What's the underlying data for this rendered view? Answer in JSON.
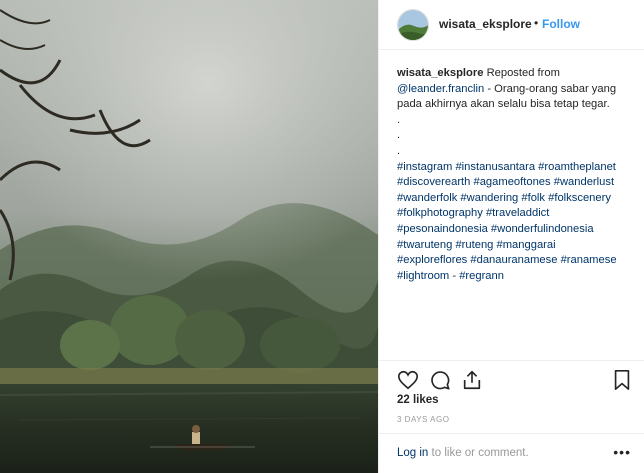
{
  "post": {
    "username": "wisata_eksplore",
    "separator": "•",
    "follow_label": "Follow"
  },
  "caption": {
    "username": "wisata_eksplore",
    "reposted_from": "Reposted from",
    "mention": "@leander.franclin",
    "text_1": "- Orang-orang sabar yang",
    "text_2": "pada akhirnya akan selalu bisa tetap tegar.",
    "dots": [
      ".",
      ".",
      "."
    ],
    "hashtag_lines": [
      "#instagram #instanusantara #roamtheplanet",
      "#discoverearth #agameoftones #wanderlust",
      "#wanderfolk #wandering #folk #folkscenery",
      "#folkphotography #traveladdict",
      "#pesonaindonesia #wonderfulindonesia",
      "#twaruteng #ruteng #manggarai",
      "#exploreflores #danauranamese #ranamese"
    ],
    "last_tags": "#lightroom",
    "last_sep": "-",
    "last_tag2": "#regrann"
  },
  "stats": {
    "likes": "22 likes",
    "time": "3 DAYS AGO"
  },
  "comment": {
    "login_label": "Log in",
    "login_rest": "to like or comment.",
    "more": "•••"
  },
  "icons": {
    "like": "heart-icon",
    "comment": "comment-icon",
    "share": "share-icon",
    "save": "bookmark-icon"
  }
}
